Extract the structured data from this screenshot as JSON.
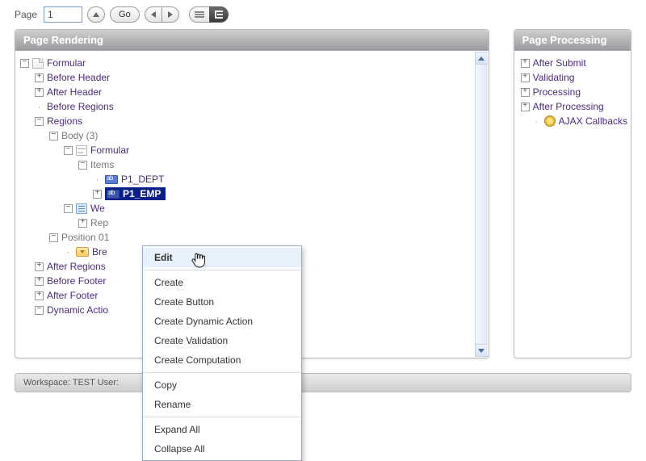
{
  "toolbar": {
    "page_label": "Page",
    "page_value": "1",
    "go_label": "Go"
  },
  "panels": {
    "rendering_title": "Page Rendering",
    "processing_title": "Page Processing"
  },
  "rendering_tree": {
    "root": "Formular",
    "before_header": "Before Header",
    "after_header": "After Header",
    "before_regions": "Before Regions",
    "regions": "Regions",
    "body": "Body (3)",
    "formular2": "Formular",
    "items": "Items",
    "p1_dept": "P1_DEPT",
    "p1_emp": "P1_EMP",
    "we_truncated": "We",
    "rep_truncated": "Rep",
    "position01": "Position 01",
    "bre_truncated": "Bre",
    "after_regions": "After Regions",
    "before_footer": "Before Footer",
    "after_footer": "After Footer",
    "dynamic_actions": "Dynamic Actio"
  },
  "processing_tree": {
    "after_submit": "After Submit",
    "validating": "Validating",
    "processing": "Processing",
    "after_processing": "After Processing",
    "ajax_callbacks": "AJAX Callbacks"
  },
  "context_menu": {
    "edit": "Edit",
    "create": "Create",
    "create_button": "Create Button",
    "create_dynamic_action": "Create Dynamic Action",
    "create_validation": "Create Validation",
    "create_computation": "Create Computation",
    "copy": "Copy",
    "rename": "Rename",
    "expand_all": "Expand All",
    "collapse_all": "Collapse All"
  },
  "statusbar": {
    "text": "Workspace: TEST User:"
  }
}
